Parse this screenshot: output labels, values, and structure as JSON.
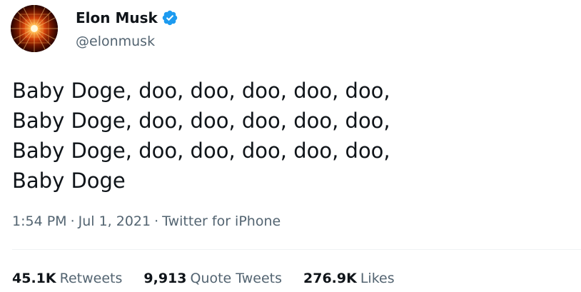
{
  "author": {
    "display_name": "Elon Musk",
    "handle": "@elonmusk",
    "verified": true,
    "verified_color": "#1d9bf0"
  },
  "tweet": {
    "text": "Baby Doge, doo, doo, doo, doo, doo,\nBaby Doge, doo, doo, doo, doo, doo,\nBaby Doge, doo, doo, doo, doo, doo,\nBaby Doge"
  },
  "meta": {
    "time": "1:54 PM",
    "date": "Jul 1, 2021",
    "separator": "·",
    "source": "Twitter for iPhone"
  },
  "stats": {
    "retweets": {
      "count": "45.1K",
      "label": "Retweets"
    },
    "quote_tweets": {
      "count": "9,913",
      "label": "Quote Tweets"
    },
    "likes": {
      "count": "276.9K",
      "label": "Likes"
    }
  },
  "icons": {
    "avatar": "avatar-image",
    "verified": "verified-badge-icon"
  }
}
